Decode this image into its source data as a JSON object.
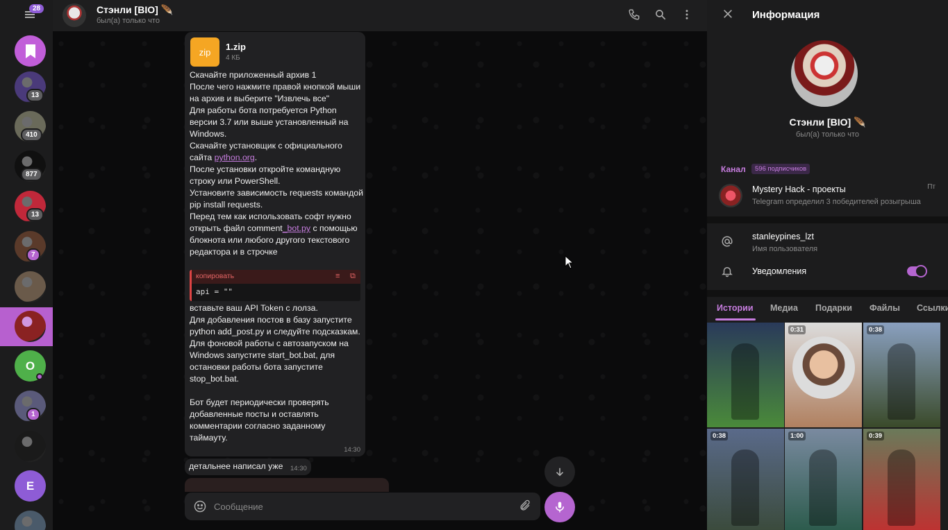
{
  "rail": {
    "menu_badge": "28",
    "chats": [
      {
        "initial": "",
        "badge": "",
        "color": "#c15ed9",
        "type": "saved"
      },
      {
        "initial": "",
        "badge": "13",
        "color": "#4a3a7a",
        "type": "img"
      },
      {
        "initial": "",
        "badge": "410",
        "color": "#6a6a5a",
        "type": "img"
      },
      {
        "initial": "",
        "badge": "877",
        "color": "#101010",
        "type": "img"
      },
      {
        "initial": "",
        "badge": "13",
        "color": "#c0283a",
        "type": "img"
      },
      {
        "initial": "",
        "badge": "7",
        "color": "#5a3a2a",
        "type": "img"
      },
      {
        "initial": "",
        "badge": "",
        "color": "#6a5a4a",
        "type": "img"
      },
      {
        "initial": "",
        "badge": "",
        "color": "#8a2222",
        "type": "img"
      },
      {
        "initial": "O",
        "badge": "",
        "color": "#4fb04a",
        "type": "letter"
      },
      {
        "initial": "",
        "badge": "1",
        "color": "#5a5a7a",
        "type": "img"
      },
      {
        "initial": "",
        "badge": "",
        "color": "#1a1a1a",
        "type": "img"
      },
      {
        "initial": "E",
        "badge": "",
        "color": "#8e5cd6",
        "type": "letter"
      },
      {
        "initial": "",
        "badge": "",
        "color": "#4a5a6a",
        "type": "img"
      }
    ]
  },
  "header": {
    "name": "Стэнли [BIO] 🪶",
    "status": "был(а) только что"
  },
  "message": {
    "file_icon_label": "zip",
    "file_name": "1.zip",
    "file_size": "4 КБ",
    "p1": "Скачайте приложенный архив 1",
    "p2": "После чего нажмите правой кнопкой мыши на архив и выберите \"Извлечь все\"",
    "p3": "Для работы бота потребуется Python версии 3.7 или выше установленный на Windows.",
    "p4a": "Скачайте установщик с официального сайта ",
    "p4link": "python.org",
    "p4b": ".",
    "p5": "После установки откройте командную строку или PowerShell.",
    "p6": "Установите зависимость requests командой pip install requests.",
    "p7a": "Перед тем как использовать софт нужно открыть файл comment",
    "p7link": "_bot.py",
    "p7b": " с помощью блокнота или любого другого текстового редактора и в строчке",
    "code_label": "копировать",
    "code": "api = \"\"",
    "p8": "вставьте ваш API Token с лолза.",
    "p9a": "Для добавления постов в базу запустите python add",
    "p9link": "_post.py",
    "p9b": " и следуйте подсказкам.",
    "p10": "Для фоновой работы с автозапуском на Windows запустите start_bot.bat, для остановки работы бота запустите stop_bot.bat.",
    "p11": "Бот будет периодически проверять добавленные посты и оставлять комментарии согласно заданному таймауту.",
    "time": "14:30"
  },
  "message2": {
    "text": "детальнее написал уже",
    "time": "14:30"
  },
  "compose": {
    "placeholder": "Сообщение"
  },
  "info": {
    "title": "Информация",
    "name": "Стэнли [BIO] 🪶",
    "status": "был(а) только что",
    "channel_label": "Канал",
    "channel_subs": "596 подписчиков",
    "channel_name": "Mystery Hack - проекты",
    "channel_time": "Пт",
    "channel_preview": "Telegram определил 3 победителей розыгрыша",
    "username": "stanleypines_lzt",
    "username_label": "Имя пользователя",
    "notifications_label": "Уведомления",
    "notifications_on": true,
    "tabs": [
      "Истории",
      "Медиа",
      "Подарки",
      "Файлы",
      "Ссылки"
    ],
    "media": [
      {
        "duration": "",
        "colors": [
          "#2a3a5a",
          "#4a8a3a"
        ]
      },
      {
        "duration": "0:31",
        "colors": [
          "#dcdcdc",
          "#b08060"
        ]
      },
      {
        "duration": "0:38",
        "colors": [
          "#8aa0c0",
          "#3a4a2a"
        ]
      },
      {
        "duration": "0:38",
        "colors": [
          "#5a6a8a",
          "#3a4a3a"
        ]
      },
      {
        "duration": "1:00",
        "colors": [
          "#7a8aa0",
          "#2a5a4a"
        ]
      },
      {
        "duration": "0:39",
        "colors": [
          "#6a7a5a",
          "#c03030"
        ]
      }
    ]
  }
}
